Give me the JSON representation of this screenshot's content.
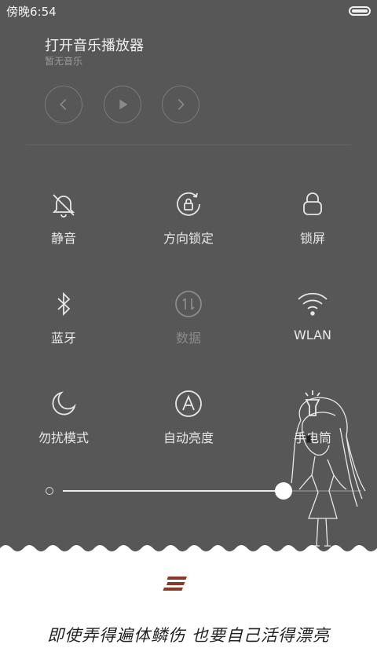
{
  "status": {
    "time": "傍晚6:54"
  },
  "music": {
    "title": "打开音乐播放器",
    "subtitle": "暂无音乐",
    "controls": [
      "chevron-left-icon",
      "play-icon",
      "chevron-right-icon"
    ]
  },
  "tiles": [
    {
      "label": "静音",
      "icon": "bell-off-icon"
    },
    {
      "label": "方向锁定",
      "icon": "rotation-lock-icon"
    },
    {
      "label": "锁屏",
      "icon": "lock-icon"
    },
    {
      "label": "蓝牙",
      "icon": "bluetooth-icon"
    },
    {
      "label": "数据",
      "icon": "mobile-data-icon",
      "disabled": true
    },
    {
      "label": "WLAN",
      "icon": "wifi-icon"
    },
    {
      "label": "勿扰模式",
      "icon": "moon-icon"
    },
    {
      "label": "自动亮度",
      "icon": "auto-brightness-icon"
    },
    {
      "label": "手电筒",
      "icon": "flashlight-icon"
    }
  ],
  "brightness": {
    "level": 0.74
  },
  "footer": {
    "quote": "即使弄得遍体鳞伤 也要自己活得漂亮",
    "menu_icon": "menu-icon"
  },
  "colors": {
    "background": "#575757",
    "panel": "#ffffff",
    "accent": "#8b3a2a"
  }
}
